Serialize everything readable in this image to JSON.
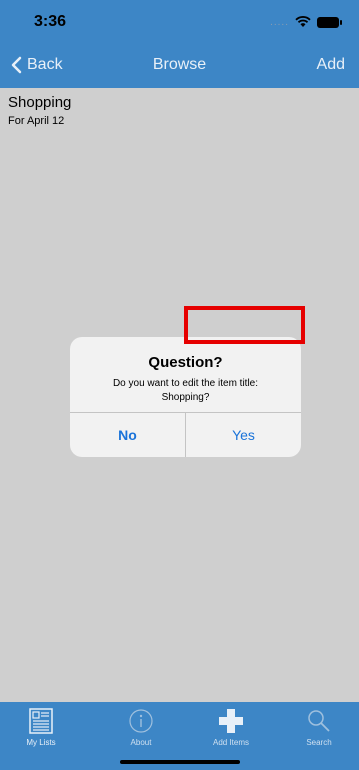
{
  "status_bar": {
    "time": "3:36",
    "signal_dots": "....."
  },
  "nav": {
    "back_label": "Back",
    "title": "Browse",
    "add_label": "Add"
  },
  "list": {
    "items": [
      {
        "title": "Shopping",
        "subtitle": "For April 12"
      }
    ]
  },
  "alert": {
    "title": "Question?",
    "message": "Do you want to edit the item title: Shopping?",
    "no_label": "No",
    "yes_label": "Yes"
  },
  "tabs": [
    {
      "label": "My Lists",
      "icon": "list-icon",
      "active": true
    },
    {
      "label": "About",
      "icon": "info-icon",
      "active": false
    },
    {
      "label": "Add Items",
      "icon": "plus-icon",
      "active": false
    },
    {
      "label": "Search",
      "icon": "search-icon",
      "active": false
    }
  ],
  "colors": {
    "bar_blue": "#3d86c6",
    "background": "#cfcfcf",
    "alert_button": "#1a73d9",
    "highlight": "#e60000"
  }
}
